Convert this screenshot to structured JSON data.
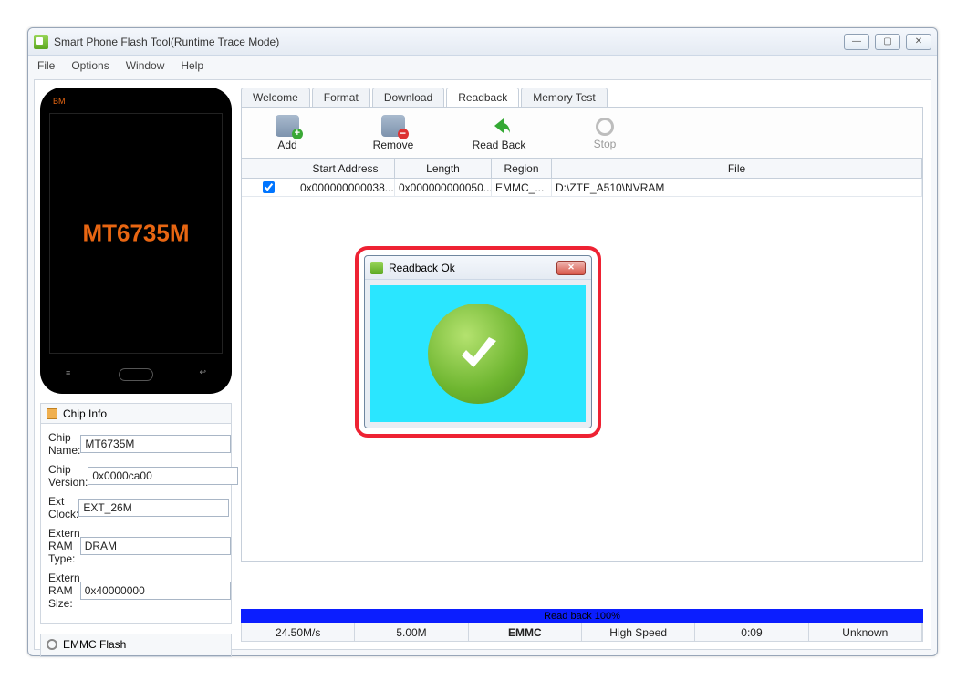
{
  "window": {
    "title": "Smart Phone Flash Tool(Runtime Trace Mode)"
  },
  "menu": {
    "file": "File",
    "options": "Options",
    "window": "Window",
    "help": "Help"
  },
  "phone": {
    "brand": "BM",
    "chip": "MT6735M"
  },
  "chip_info": {
    "title": "Chip Info",
    "name_label": "Chip Name:",
    "name_value": "MT6735M",
    "version_label": "Chip Version:",
    "version_value": "0x0000ca00",
    "ext_clock_label": "Ext Clock:",
    "ext_clock_value": "EXT_26M",
    "ram_type_label": "Extern RAM Type:",
    "ram_type_value": "DRAM",
    "ram_size_label": "Extern RAM Size:",
    "ram_size_value": "0x40000000"
  },
  "emmc_panel": {
    "title": "EMMC Flash"
  },
  "tabs": {
    "welcome": "Welcome",
    "format": "Format",
    "download": "Download",
    "readback": "Readback",
    "memory": "Memory Test"
  },
  "toolbar": {
    "add": "Add",
    "remove": "Remove",
    "readback": "Read Back",
    "stop": "Stop"
  },
  "grid": {
    "headers": {
      "start": "Start Address",
      "length": "Length",
      "region": "Region",
      "file": "File"
    },
    "row0": {
      "start": "0x000000000038...",
      "length": "0x000000000050...",
      "region": "EMMC_...",
      "file": "D:\\ZTE_A510\\NVRAM"
    }
  },
  "dialog": {
    "title": "Readback Ok"
  },
  "status": {
    "progress_text": "Read back 100%",
    "speed": "24.50M/s",
    "total": "5.00M",
    "type": "EMMC",
    "mode": "High Speed",
    "time": "0:09",
    "extra": "Unknown"
  }
}
